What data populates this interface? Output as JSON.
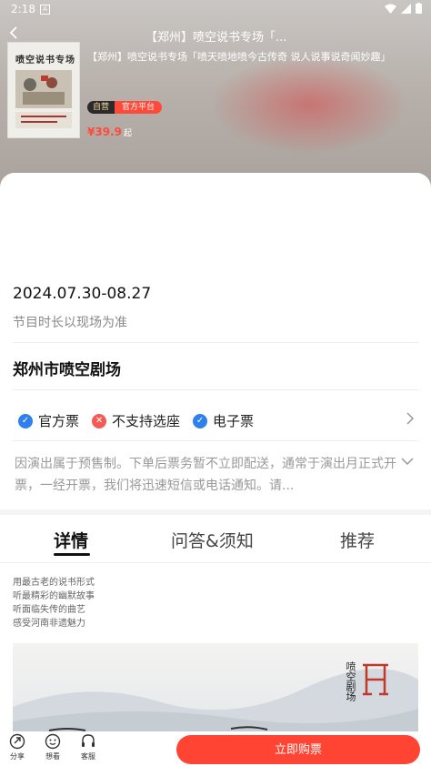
{
  "status_bar": {
    "time": "2:18",
    "notification_icon": "A"
  },
  "nav": {
    "title": "【郑州】喷空说书专场「..."
  },
  "hero": {
    "poster_title": "喷空说书专场",
    "title": "【郑州】喷空说书专场「喷天喷地喷今古传奇 说人说事说奇闻妙趣」",
    "badge_self": "自营",
    "badge_official": "官方平台",
    "price": "¥39.9",
    "price_suffix": "起"
  },
  "info": {
    "dates": "2024.07.30-08.27",
    "duration_note": "节目时长以现场为准",
    "venue": "郑州市喷空剧场",
    "features": [
      {
        "label": "官方票",
        "icon": "check-icon",
        "color": "#2f80ed"
      },
      {
        "label": "不支持选座",
        "icon": "cross-icon",
        "color": "#f25c54"
      },
      {
        "label": "电子票",
        "icon": "check-icon",
        "color": "#2f80ed"
      }
    ],
    "notice": "因演出属于预售制。下单后票务暂不立即配送，通常于演出月正式开票，一经开票，我们将迅速短信或电话通知。请..."
  },
  "tabs": [
    {
      "label": "详情",
      "active": true
    },
    {
      "label": "问答&须知",
      "active": false
    },
    {
      "label": "推荐",
      "active": false
    }
  ],
  "detail": {
    "intro_lines": [
      "用最古老的说书形式",
      "听最精彩的幽默故事",
      "听面临失传的曲艺",
      "感受河南非遗魅力"
    ],
    "banner_logo": "喷空剧场"
  },
  "bottom_bar": {
    "share": "分享",
    "want": "想看",
    "service": "客服",
    "buy": "立即购票"
  },
  "colors": {
    "accent": "#ff4433",
    "check": "#2f80ed",
    "cross": "#f25c54"
  }
}
